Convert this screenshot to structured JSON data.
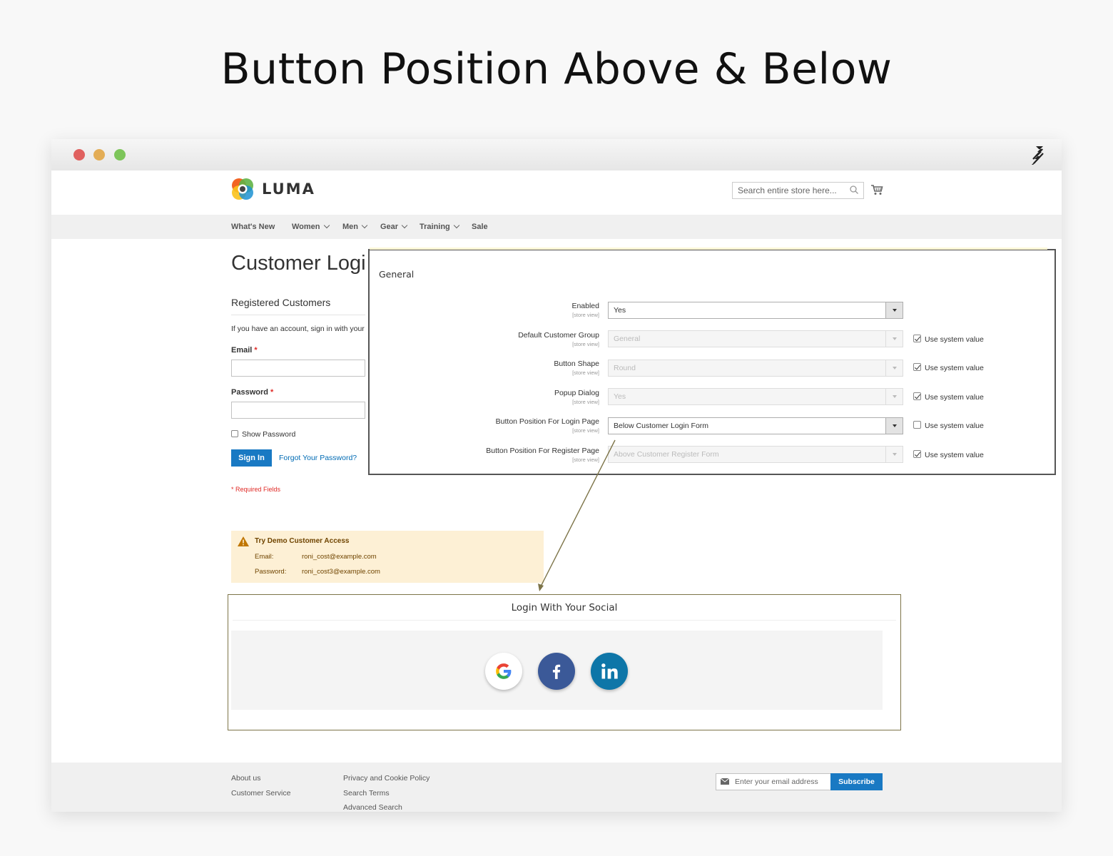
{
  "headline": "Button Position Above & Below",
  "window": {
    "dots": [
      "#e0615f",
      "#e3ad56",
      "#7dc55a"
    ]
  },
  "store": {
    "logo_text": "LUMA",
    "search_placeholder": "Search entire store here...",
    "nav": [
      "What's New",
      "Women",
      "Men",
      "Gear",
      "Training",
      "Sale"
    ]
  },
  "login": {
    "title": "Customer Login",
    "section": "Registered Customers",
    "intro": "If you have an account, sign in with your email address.",
    "email_label": "Email",
    "password_label": "Password",
    "required_mark": "*",
    "show_password": "Show Password",
    "sign_in": "Sign In",
    "forgot": "Forgot Your Password?",
    "required_note": "* Required Fields"
  },
  "demo": {
    "title": "Try Demo Customer Access",
    "email_key": "Email:",
    "email_value": "roni_cost@example.com",
    "password_key": "Password:",
    "password_value": "roni_cost3@example.com"
  },
  "social": {
    "title": "Login With Your Social",
    "buttons": [
      {
        "name": "google",
        "color": "#ffffff"
      },
      {
        "name": "facebook",
        "color": "#3b5998"
      },
      {
        "name": "linkedin",
        "color": "#0e76a8"
      }
    ]
  },
  "footer": {
    "col1": [
      "About us",
      "Customer Service"
    ],
    "col2": [
      "Privacy and Cookie Policy",
      "Search Terms",
      "Advanced Search"
    ],
    "newsletter_placeholder": "Enter your email address",
    "subscribe": "Subscribe"
  },
  "config": {
    "section": "General",
    "scope": "[store view]",
    "use_system": "Use system value",
    "rows": [
      {
        "label": "Enabled",
        "value": "Yes",
        "disabled": false,
        "use_system": null
      },
      {
        "label": "Default Customer Group",
        "value": "General",
        "disabled": true,
        "use_system": true
      },
      {
        "label": "Button Shape",
        "value": "Round",
        "disabled": true,
        "use_system": true
      },
      {
        "label": "Popup Dialog",
        "value": "Yes",
        "disabled": true,
        "use_system": true
      },
      {
        "label": "Button Position For Login Page",
        "value": "Below Customer Login Form",
        "disabled": false,
        "use_system": false
      },
      {
        "label": "Button Position For Register Page",
        "value": "Above Customer Register Form",
        "disabled": true,
        "use_system": true
      }
    ]
  },
  "colors": {
    "accent": "#1979c3",
    "link": "#006bb4",
    "required": "#e02b27",
    "frame": "#7d7448"
  }
}
